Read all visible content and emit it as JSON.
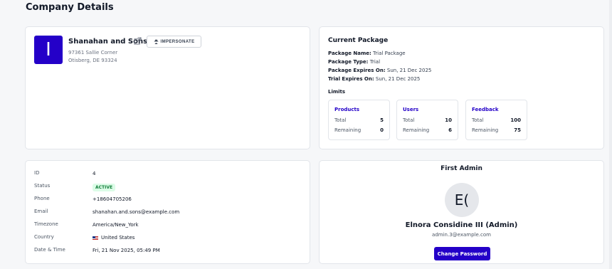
{
  "page": {
    "title": "Company Details"
  },
  "company": {
    "logo_letter": "I",
    "name": "Shanahan and Sons",
    "impersonate_label": "IMPERSONATE",
    "address_line1": "97361 Sallie Corner",
    "address_line2": "Otisberg, DE 93324"
  },
  "package": {
    "title": "Current Package",
    "name_label": "Package Name:",
    "name_value": "Trial Package",
    "type_label": "Package Type:",
    "type_value": "Trial",
    "expires_label": "Package Expires On:",
    "expires_value": "Sun, 21 Dec 2025",
    "trial_label": "Trial Expires On:",
    "trial_value": "Sun, 21 Dec 2025",
    "limits_title": "Limits",
    "limits": [
      {
        "name": "Products",
        "total_label": "Total",
        "total": "5",
        "remaining_label": "Remaining",
        "remaining": "0"
      },
      {
        "name": "Users",
        "total_label": "Total",
        "total": "10",
        "remaining_label": "Remaining",
        "remaining": "6"
      },
      {
        "name": "Feedback",
        "total_label": "Total",
        "total": "100",
        "remaining_label": "Remaining",
        "remaining": "75"
      }
    ]
  },
  "info": {
    "id_label": "ID",
    "id_value": "4",
    "status_label": "Status",
    "status_value": "ACTIVE",
    "phone_label": "Phone",
    "phone_value": "+18604705206",
    "email_label": "Email",
    "email_value": "shanahan.and.sons@example.com",
    "timezone_label": "Timezone",
    "timezone_value": "America/New_York",
    "country_label": "Country",
    "country_value": "United States",
    "datetime_label": "Date & Time",
    "datetime_value": "Fri, 21 Nov 2025, 05:49 PM"
  },
  "admin": {
    "heading": "First Admin",
    "initials": "E(",
    "name": "Elnora Considine III (Admin)",
    "email": "admin.3@example.com",
    "change_password_label": "Change Password"
  },
  "colors": {
    "accent": "#2400c8",
    "status_bg": "#dcfce7",
    "status_fg": "#15803d"
  }
}
